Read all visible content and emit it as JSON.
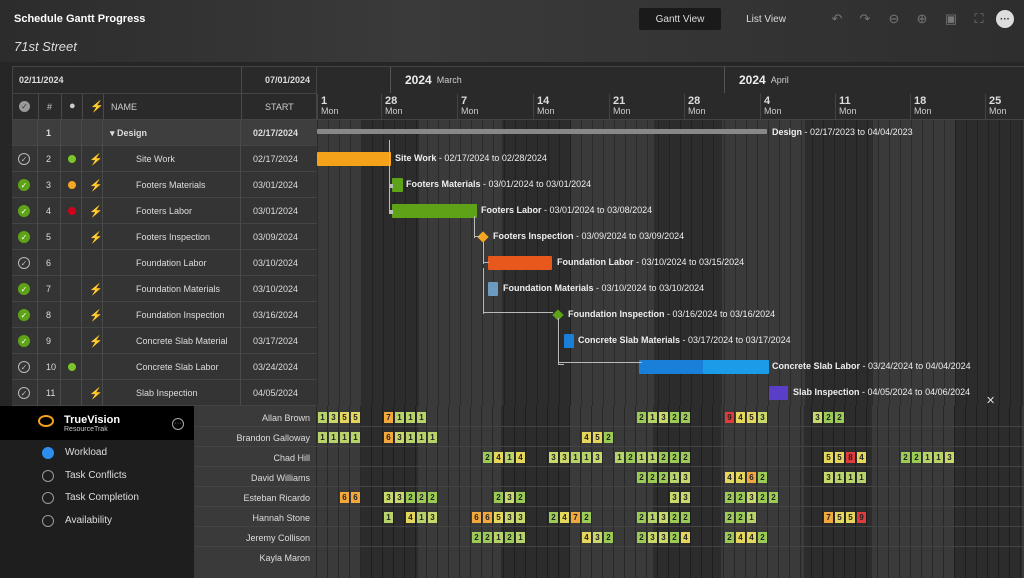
{
  "header": {
    "title": "Schedule Gantt Progress",
    "subtitle": "71st Street",
    "view_gantt": "Gantt View",
    "view_list": "List View"
  },
  "table": {
    "date_from": "02/11/2024",
    "date_to": "07/01/2024",
    "col_num": "#",
    "col_name": "NAME",
    "col_start": "START",
    "rows": [
      {
        "num": "1",
        "name": "Design",
        "start": "02/17/2024",
        "check": "",
        "status": "",
        "flash": false,
        "group": true
      },
      {
        "num": "2",
        "name": "Site Work",
        "start": "02/17/2024",
        "check": "open",
        "status": "#7bc62d",
        "flash": true
      },
      {
        "num": "3",
        "name": "Footers Materials",
        "start": "03/01/2024",
        "check": "done",
        "status": "#f5a623",
        "flash": true
      },
      {
        "num": "4",
        "name": "Footers Labor",
        "start": "03/01/2024",
        "check": "done",
        "status": "#d0021b",
        "flash": true
      },
      {
        "num": "5",
        "name": "Footers Inspection",
        "start": "03/09/2024",
        "check": "done",
        "status": "",
        "flash": true
      },
      {
        "num": "6",
        "name": "Foundation Labor",
        "start": "03/10/2024",
        "check": "open",
        "status": "",
        "flash": false
      },
      {
        "num": "7",
        "name": "Foundation Materials",
        "start": "03/10/2024",
        "check": "done",
        "status": "",
        "flash": true
      },
      {
        "num": "8",
        "name": "Foundation Inspection",
        "start": "03/16/2024",
        "check": "done",
        "status": "",
        "flash": true
      },
      {
        "num": "9",
        "name": "Concrete Slab Material",
        "start": "03/17/2024",
        "check": "done",
        "status": "",
        "flash": true
      },
      {
        "num": "10",
        "name": "Concrete Slab Labor",
        "start": "03/24/2024",
        "check": "open",
        "status": "#7bc62d",
        "flash": false
      },
      {
        "num": "11",
        "name": "Slab Inspection",
        "start": "04/05/2024",
        "check": "open",
        "status": "",
        "flash": true
      }
    ]
  },
  "timeline": {
    "months": [
      {
        "year": "2024",
        "name": "March"
      },
      {
        "year": "2024",
        "name": "April"
      }
    ],
    "weeks": [
      {
        "d": "1",
        "w": "Mon"
      },
      {
        "d": "28",
        "w": "Mon"
      },
      {
        "d": "7",
        "w": "Mon"
      },
      {
        "d": "14",
        "w": "Mon"
      },
      {
        "d": "21",
        "w": "Mon"
      },
      {
        "d": "28",
        "w": "Mon"
      },
      {
        "d": "4",
        "w": "Mon"
      },
      {
        "d": "11",
        "w": "Mon"
      },
      {
        "d": "18",
        "w": "Mon"
      },
      {
        "d": "25",
        "w": "Mon"
      }
    ]
  },
  "bars": [
    {
      "name": "Design",
      "range": "02/17/2023 to 04/04/2023"
    },
    {
      "name": "Site Work",
      "range": "02/17/2024 to 02/28/2024"
    },
    {
      "name": "Footers Materials",
      "range": "03/01/2024 to 03/01/2024"
    },
    {
      "name": "Footers Labor",
      "range": "03/01/2024 to 03/08/2024"
    },
    {
      "name": "Footers Inspection",
      "range": "03/09/2024 to 03/09/2024"
    },
    {
      "name": "Foundation Labor",
      "range": "03/10/2024 to 03/15/2024"
    },
    {
      "name": "Foundation Materials",
      "range": "03/10/2024 to 03/10/2024"
    },
    {
      "name": "Foundation Inspection",
      "range": "03/16/2024 to 03/16/2024"
    },
    {
      "name": "Concrete Slab Materials",
      "range": "03/17/2024 to 03/17/2024"
    },
    {
      "name": "Concrete Slab Labor",
      "range": "03/24/2024 to 04/04/2024"
    },
    {
      "name": "Slab Inspection",
      "range": "04/05/2024 to 04/06/2024"
    }
  ],
  "colors": {
    "orange": "#f5a21b",
    "green": "#5ea317",
    "orange_red": "#e8581c",
    "steel": "#6b9bc3",
    "blue": "#1a7fd8",
    "purple": "#5b3ec8",
    "diamond_orange": "#f5a623",
    "diamond_green": "#5ea317"
  },
  "resource": {
    "brand": "TrueVision",
    "brand_sub": "ResourceTrak",
    "options": [
      "Workload",
      "Task Conflicts",
      "Task Completion",
      "Availability"
    ],
    "selected": "Workload"
  },
  "people": [
    "Allan Brown",
    "Brandon Galloway",
    "Chad Hill",
    "David Williams",
    "Esteban Ricardo",
    "Hannah Stone",
    "Jeremy Collison",
    "Kayla Maron"
  ],
  "workload": [
    [
      [
        0,
        "1"
      ],
      [
        1,
        "3"
      ],
      [
        2,
        "5"
      ],
      [
        3,
        "5"
      ],
      [
        6,
        "7"
      ],
      [
        7,
        "1"
      ],
      [
        8,
        "1"
      ],
      [
        9,
        "1"
      ],
      [
        29,
        "2"
      ],
      [
        30,
        "1"
      ],
      [
        31,
        "3"
      ],
      [
        32,
        "2"
      ],
      [
        33,
        "2"
      ],
      [
        37,
        "9"
      ],
      [
        38,
        "4"
      ],
      [
        39,
        "5"
      ],
      [
        40,
        "3"
      ],
      [
        45,
        "3"
      ],
      [
        46,
        "2"
      ],
      [
        47,
        "2"
      ]
    ],
    [
      [
        0,
        "1"
      ],
      [
        1,
        "1"
      ],
      [
        2,
        "1"
      ],
      [
        3,
        "1"
      ],
      [
        6,
        "6"
      ],
      [
        7,
        "3"
      ],
      [
        8,
        "1"
      ],
      [
        9,
        "1"
      ],
      [
        10,
        "1"
      ],
      [
        24,
        "4"
      ],
      [
        25,
        "5"
      ],
      [
        26,
        "2"
      ]
    ],
    [
      [
        15,
        "2"
      ],
      [
        16,
        "4"
      ],
      [
        17,
        "1"
      ],
      [
        18,
        "4"
      ],
      [
        21,
        "3"
      ],
      [
        22,
        "3"
      ],
      [
        23,
        "1"
      ],
      [
        24,
        "1"
      ],
      [
        25,
        "3"
      ],
      [
        27,
        "1"
      ],
      [
        28,
        "2"
      ],
      [
        29,
        "1"
      ],
      [
        30,
        "1"
      ],
      [
        31,
        "2"
      ],
      [
        32,
        "2"
      ],
      [
        33,
        "2"
      ],
      [
        46,
        "5"
      ],
      [
        47,
        "5"
      ],
      [
        48,
        "8"
      ],
      [
        49,
        "4"
      ],
      [
        53,
        "2"
      ],
      [
        54,
        "2"
      ],
      [
        55,
        "1"
      ],
      [
        56,
        "1"
      ],
      [
        57,
        "3"
      ]
    ],
    [
      [
        29,
        "2"
      ],
      [
        30,
        "2"
      ],
      [
        31,
        "2"
      ],
      [
        32,
        "1"
      ],
      [
        33,
        "3"
      ],
      [
        37,
        "4"
      ],
      [
        38,
        "4"
      ],
      [
        39,
        "6"
      ],
      [
        40,
        "2"
      ],
      [
        46,
        "3"
      ],
      [
        47,
        "1"
      ],
      [
        48,
        "1"
      ],
      [
        49,
        "1"
      ]
    ],
    [
      [
        2,
        "6"
      ],
      [
        3,
        "6"
      ],
      [
        6,
        "3"
      ],
      [
        7,
        "3"
      ],
      [
        8,
        "2"
      ],
      [
        9,
        "2"
      ],
      [
        10,
        "2"
      ],
      [
        16,
        "2"
      ],
      [
        17,
        "3"
      ],
      [
        18,
        "2"
      ],
      [
        32,
        "3"
      ],
      [
        33,
        "3"
      ],
      [
        37,
        "2"
      ],
      [
        38,
        "2"
      ],
      [
        39,
        "3"
      ],
      [
        40,
        "2"
      ],
      [
        41,
        "2"
      ]
    ],
    [
      [
        6,
        "1"
      ],
      [
        8,
        "4"
      ],
      [
        9,
        "1"
      ],
      [
        10,
        "3"
      ],
      [
        14,
        "6"
      ],
      [
        15,
        "6"
      ],
      [
        16,
        "5"
      ],
      [
        17,
        "3"
      ],
      [
        18,
        "3"
      ],
      [
        21,
        "2"
      ],
      [
        22,
        "4"
      ],
      [
        23,
        "7"
      ],
      [
        24,
        "2"
      ],
      [
        29,
        "2"
      ],
      [
        30,
        "1"
      ],
      [
        31,
        "3"
      ],
      [
        32,
        "2"
      ],
      [
        33,
        "2"
      ],
      [
        37,
        "2"
      ],
      [
        38,
        "2"
      ],
      [
        39,
        "1"
      ],
      [
        46,
        "7"
      ],
      [
        47,
        "5"
      ],
      [
        48,
        "5"
      ],
      [
        49,
        "9"
      ]
    ],
    [
      [
        14,
        "2"
      ],
      [
        15,
        "2"
      ],
      [
        16,
        "1"
      ],
      [
        17,
        "2"
      ],
      [
        18,
        "1"
      ],
      [
        24,
        "4"
      ],
      [
        25,
        "3"
      ],
      [
        26,
        "2"
      ],
      [
        29,
        "2"
      ],
      [
        30,
        "3"
      ],
      [
        31,
        "3"
      ],
      [
        32,
        "2"
      ],
      [
        33,
        "4"
      ],
      [
        37,
        "2"
      ],
      [
        38,
        "4"
      ],
      [
        39,
        "4"
      ],
      [
        40,
        "2"
      ]
    ],
    []
  ]
}
